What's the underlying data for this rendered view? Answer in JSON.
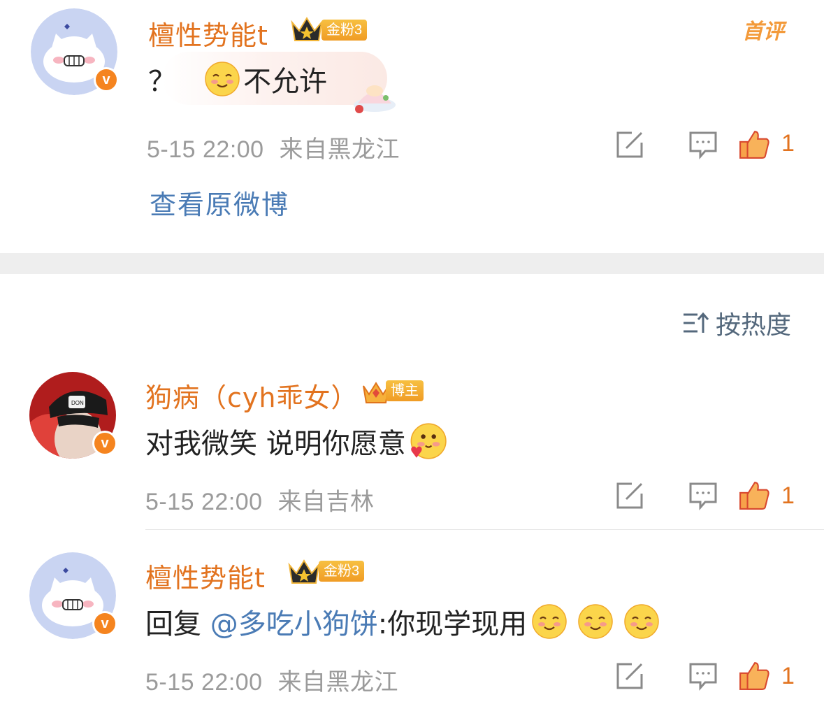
{
  "top_comment": {
    "username": "檀性势能t",
    "badge": "金粉3",
    "first_tag": "首评",
    "text_prefix": "？",
    "text_suffix": "不允许",
    "time": "5-15 22:00",
    "location": "来自黑龙江",
    "likes": "1",
    "view_original": "查看原微博"
  },
  "sort": {
    "label": "按热度"
  },
  "comments": [
    {
      "username": "狗病（cyh乖女）",
      "badge": "博主",
      "text": "对我微笑 说明你愿意",
      "time": "5-15 22:00",
      "location": "来自吉林",
      "likes": "1"
    },
    {
      "username": "檀性势能t",
      "badge": "金粉3",
      "reply_prefix": "回复 ",
      "mention": "@多吃小狗饼",
      "text": ":你现学现用",
      "time": "5-15 22:00",
      "location": "来自黑龙江",
      "likes": "1"
    }
  ],
  "colors": {
    "username": "#e2731f",
    "link": "#4a7bb5",
    "meta": "#9b9b9b",
    "divider": "#eeeeee"
  }
}
